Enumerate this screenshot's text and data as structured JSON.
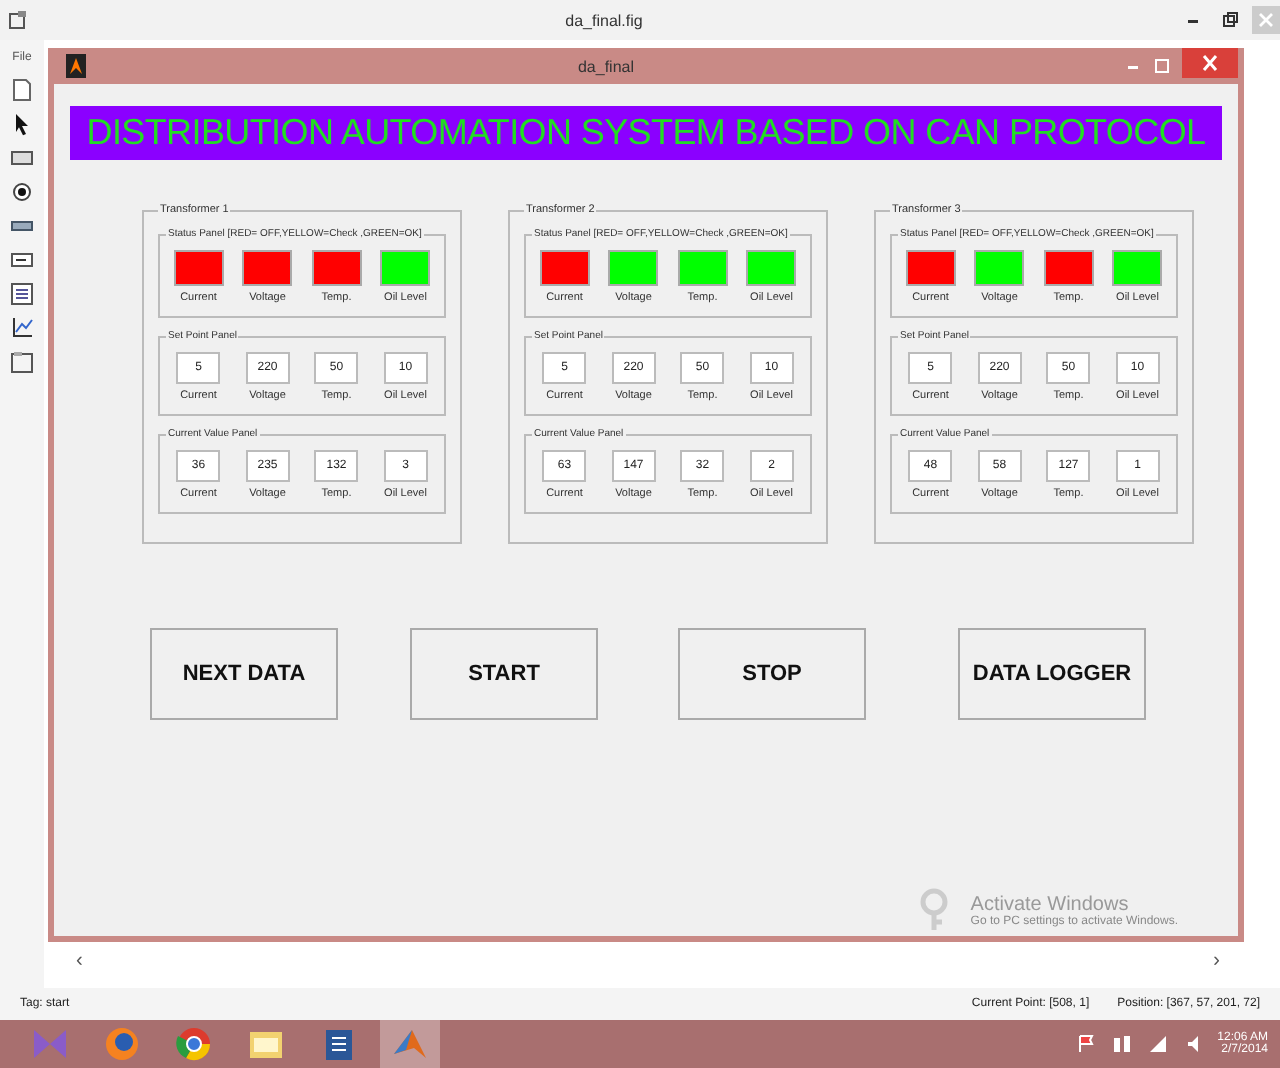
{
  "outer_window": {
    "title": "da_final.fig",
    "menu": [
      "File"
    ]
  },
  "window": {
    "title": "da_final"
  },
  "banner": "DISTRIBUTION AUTOMATION SYSTEM BASED ON CAN PROTOCOL",
  "transformers": [
    {
      "title": "Transformer 1",
      "status_panel": {
        "title": "Status Panel [RED= OFF,YELLOW=Check ,GREEN=OK]",
        "indicators": [
          {
            "label": "Current",
            "color": "#ff0000"
          },
          {
            "label": "Voltage",
            "color": "#ff0000"
          },
          {
            "label": "Temp.",
            "color": "#ff0000"
          },
          {
            "label": "Oil Level",
            "color": "#00ff00"
          }
        ]
      },
      "set_point_panel": {
        "title": "Set Point Panel",
        "fields": [
          {
            "value": "5",
            "label": "Current"
          },
          {
            "value": "220",
            "label": "Voltage"
          },
          {
            "value": "50",
            "label": "Temp."
          },
          {
            "value": "10",
            "label": "Oil Level"
          }
        ]
      },
      "current_value_panel": {
        "title": "Current Value Panel",
        "fields": [
          {
            "value": "36",
            "label": "Current"
          },
          {
            "value": "235",
            "label": "Voltage"
          },
          {
            "value": "132",
            "label": "Temp."
          },
          {
            "value": "3",
            "label": "Oil Level"
          }
        ]
      }
    },
    {
      "title": "Transformer 2",
      "status_panel": {
        "title": "Status Panel [RED= OFF,YELLOW=Check ,GREEN=OK]",
        "indicators": [
          {
            "label": "Current",
            "color": "#ff0000"
          },
          {
            "label": "Voltage",
            "color": "#00ff00"
          },
          {
            "label": "Temp.",
            "color": "#00ff00"
          },
          {
            "label": "Oil Level",
            "color": "#00ff00"
          }
        ]
      },
      "set_point_panel": {
        "title": "Set Point Panel",
        "fields": [
          {
            "value": "5",
            "label": "Current"
          },
          {
            "value": "220",
            "label": "Voltage"
          },
          {
            "value": "50",
            "label": "Temp."
          },
          {
            "value": "10",
            "label": "Oil Level"
          }
        ]
      },
      "current_value_panel": {
        "title": "Current Value Panel",
        "fields": [
          {
            "value": "63",
            "label": "Current"
          },
          {
            "value": "147",
            "label": "Voltage"
          },
          {
            "value": "32",
            "label": "Temp."
          },
          {
            "value": "2",
            "label": "Oil Level"
          }
        ]
      }
    },
    {
      "title": "Transformer 3",
      "status_panel": {
        "title": "Status Panel [RED= OFF,YELLOW=Check ,GREEN=OK]",
        "indicators": [
          {
            "label": "Current",
            "color": "#ff0000"
          },
          {
            "label": "Voltage",
            "color": "#00ff00"
          },
          {
            "label": "Temp.",
            "color": "#ff0000"
          },
          {
            "label": "Oil Level",
            "color": "#00ff00"
          }
        ]
      },
      "set_point_panel": {
        "title": "Set Point Panel",
        "fields": [
          {
            "value": "5",
            "label": "Current"
          },
          {
            "value": "220",
            "label": "Voltage"
          },
          {
            "value": "50",
            "label": "Temp."
          },
          {
            "value": "10",
            "label": "Oil Level"
          }
        ]
      },
      "current_value_panel": {
        "title": "Current Value Panel",
        "fields": [
          {
            "value": "48",
            "label": "Current"
          },
          {
            "value": "58",
            "label": "Voltage"
          },
          {
            "value": "127",
            "label": "Temp."
          },
          {
            "value": "1",
            "label": "Oil Level"
          }
        ]
      }
    }
  ],
  "buttons": [
    "NEXT DATA",
    "START",
    "STOP",
    "DATA LOGGER"
  ],
  "activation_notice": {
    "title": "Activate Windows",
    "text": "Go to PC settings to activate Windows."
  },
  "scrollbar": {
    "left": "‹",
    "right": "›"
  },
  "status_bar": {
    "tag": "Tag: start",
    "current_point": "Current Point: [508, 1]",
    "position": "Position: [367, 57, 201, 72]"
  },
  "taskbar": {
    "time": "12:06 AM",
    "date": "2/7/2014"
  }
}
